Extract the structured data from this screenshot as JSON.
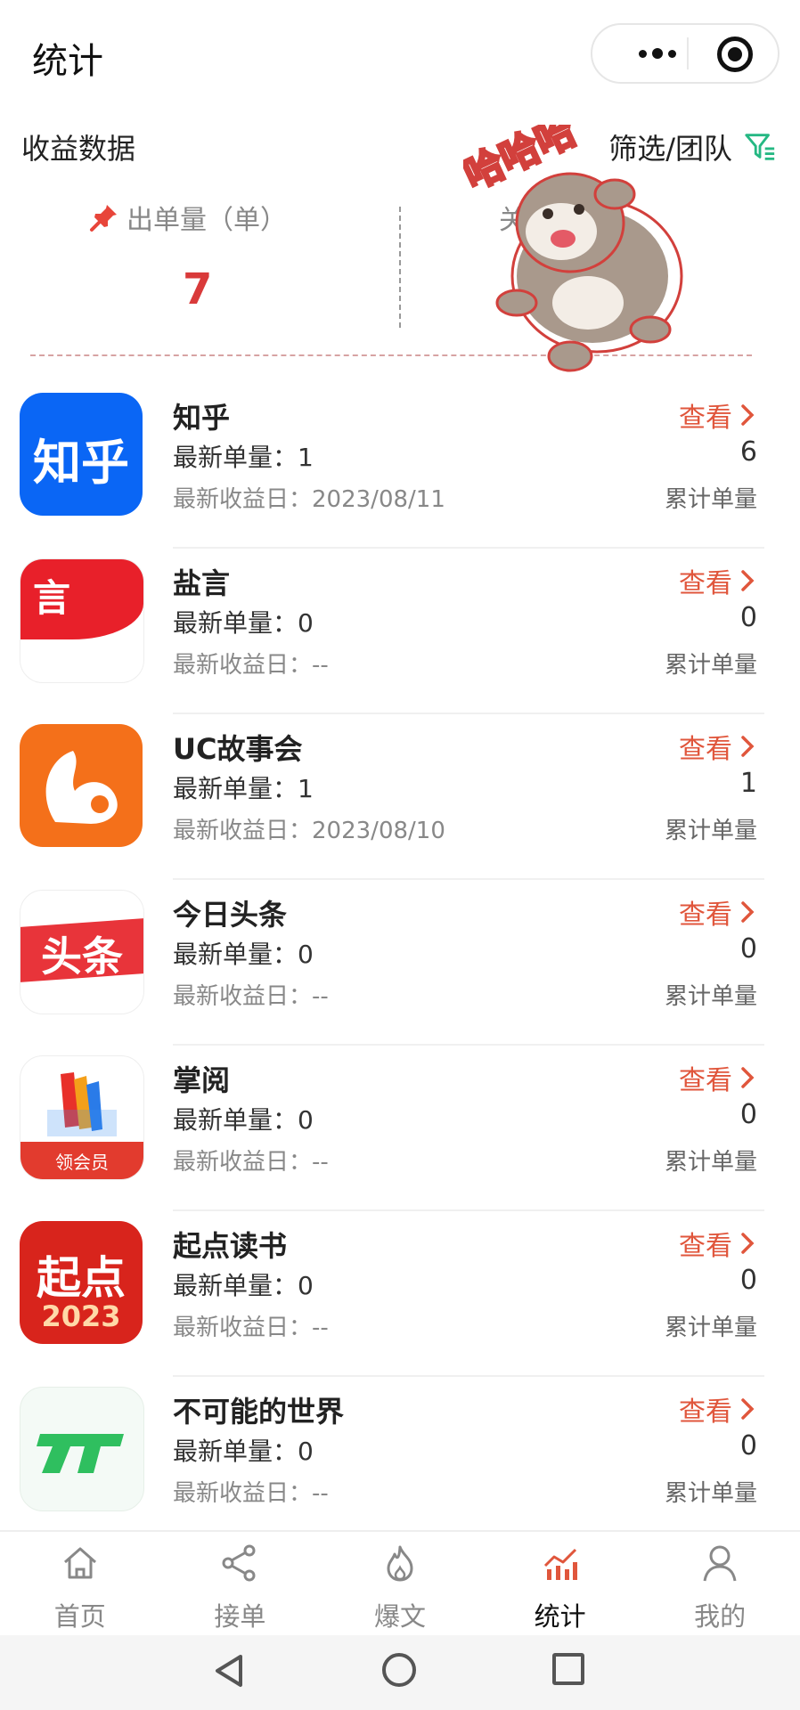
{
  "header": {
    "title": "统计"
  },
  "section": {
    "title": "收益数据",
    "filter_label": "筛选/团队"
  },
  "stats": {
    "orders_label": "出单量（单）",
    "orders_value": "7",
    "second_label_partial": "关"
  },
  "sticker": {
    "text": "哈哈哈"
  },
  "apps": [
    {
      "name": "知乎",
      "icon_text": "知乎",
      "latest_label": "最新单量：",
      "latest_value": "1",
      "date_label": "最新收益日：",
      "date_value": "2023/08/11",
      "view_label": "查看",
      "total_value": "6",
      "total_label": "累计单量",
      "color": "#0a66f5"
    },
    {
      "name": "盐言",
      "icon_text": "言",
      "latest_label": "最新单量：",
      "latest_value": "0",
      "date_label": "最新收益日：",
      "date_value": "--",
      "view_label": "查看",
      "total_value": "0",
      "total_label": "累计单量",
      "color": "#e8202a"
    },
    {
      "name": "UC故事会",
      "icon_text": "",
      "latest_label": "最新单量：",
      "latest_value": "1",
      "date_label": "最新收益日：",
      "date_value": "2023/08/10",
      "view_label": "查看",
      "total_value": "1",
      "total_label": "累计单量",
      "color": "#f4701a"
    },
    {
      "name": "今日头条",
      "icon_text": "头条",
      "latest_label": "最新单量：",
      "latest_value": "0",
      "date_label": "最新收益日：",
      "date_value": "--",
      "view_label": "查看",
      "total_value": "0",
      "total_label": "累计单量",
      "color": "#e8343a"
    },
    {
      "name": "掌阅",
      "icon_text": "领会员",
      "latest_label": "最新单量：",
      "latest_value": "0",
      "date_label": "最新收益日：",
      "date_value": "--",
      "view_label": "查看",
      "total_value": "0",
      "total_label": "累计单量",
      "color": "#e23b2e"
    },
    {
      "name": "起点读书",
      "icon_text": "起点",
      "icon_subtext": "2023",
      "latest_label": "最新单量：",
      "latest_value": "0",
      "date_label": "最新收益日：",
      "date_value": "--",
      "view_label": "查看",
      "total_value": "0",
      "total_label": "累计单量",
      "color": "#d8241c"
    },
    {
      "name": "不可能的世界",
      "icon_text": "",
      "latest_label": "最新单量：",
      "latest_value": "0",
      "date_label": "最新收益日：",
      "date_value": "--",
      "view_label": "查看",
      "total_value": "0",
      "total_label": "累计单量",
      "color": "#2fbf5f"
    }
  ],
  "tabs": [
    {
      "label": "首页",
      "icon": "home-icon"
    },
    {
      "label": "接单",
      "icon": "share-icon"
    },
    {
      "label": "爆文",
      "icon": "flame-icon"
    },
    {
      "label": "统计",
      "icon": "chart-icon",
      "active": true
    },
    {
      "label": "我的",
      "icon": "user-icon"
    }
  ],
  "colors": {
    "accent": "#e0563c",
    "value_red": "#d93a3a",
    "filter_green": "#25b883"
  }
}
